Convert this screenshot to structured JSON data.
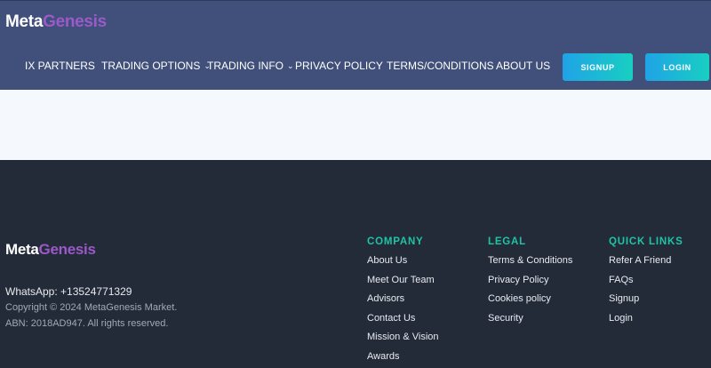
{
  "brand": {
    "part1": "Meta",
    "part2": "Genesis",
    "color_primary": "#ffffff",
    "color_accent": "#9b59c9"
  },
  "nav": {
    "items": [
      {
        "label": "IX PARTNERS",
        "dropdown": false
      },
      {
        "label": "TRADING OPTIONS",
        "dropdown": true
      },
      {
        "label": "TRADING INFO",
        "dropdown": true
      },
      {
        "label": "PRIVACY POLICY",
        "dropdown": false
      },
      {
        "label": "TERMS/CONDITIONS",
        "dropdown": false
      },
      {
        "label": "ABOUT US",
        "dropdown": false
      }
    ],
    "chevron_icon": "chevron-down-icon",
    "signup_label": "SIGNUP",
    "login_label": "LOGIN"
  },
  "footer": {
    "whatsapp": "WhatsApp: +13524771329",
    "copyright": "Copyright © 2024 MetaGenesis Market.",
    "abn": "ABN: 2018AD947. All rights reserved.",
    "columns": [
      {
        "title": "COMPANY",
        "links": [
          "About Us",
          "Meet Our Team",
          "Advisors",
          "Contact Us",
          "Mission & Vision",
          "Awards"
        ]
      },
      {
        "title": "LEGAL",
        "links": [
          "Terms & Conditions",
          "Privacy Policy",
          "Cookies policy",
          "Security"
        ]
      },
      {
        "title": "QUICK LINKS",
        "links": [
          "Refer A Friend",
          "FAQs",
          "Signup",
          "Login"
        ]
      }
    ]
  },
  "colors": {
    "header_bg": "#41507a",
    "footer_bg": "#232a38",
    "band_bg": "#f5f9fd",
    "heading_teal": "#1fc4a4",
    "button_gradient_start": "#20a3e6",
    "button_gradient_end": "#18cfc2"
  }
}
